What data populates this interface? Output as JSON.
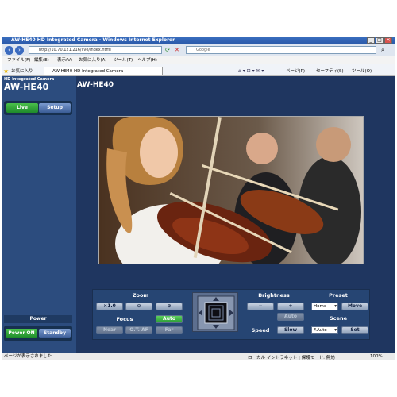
{
  "window": {
    "title": "AW-HE40 HD Integrated Camera - Windows Internet Explorer",
    "min": "_",
    "max": "□",
    "close": "✕"
  },
  "browser": {
    "back_icon": "back-arrow-icon",
    "address": "http://10.70.121.216/live/index.html",
    "search_placeholder": "Google",
    "menu": [
      "ファイル(F)",
      "編集(E)",
      "表示(V)",
      "お気に入り(A)",
      "ツール(T)",
      "ヘルプ(H)"
    ],
    "favorites": "お気に入り",
    "tab_title": "AW-HE40 HD Integrated Camera",
    "toolbar": [
      "ページ(P)",
      "セーフティ(S)",
      "ツール(O)"
    ]
  },
  "app": {
    "product_sub": "HD Integrated Camera",
    "product": "AW-HE40",
    "header_title": "AW-HE40",
    "live": "Live",
    "setup": "Setup",
    "power_label": "Power",
    "power_on": "Power ON",
    "standby": "Standby"
  },
  "controls": {
    "zoom_label": "Zoom",
    "zoom_x1": "×1.0",
    "focus_label": "Focus",
    "focus_auto": "Auto",
    "focus_near": "Near",
    "focus_otaf": "O.T. AF",
    "focus_far": "Far",
    "brightness_label": "Brightness",
    "brightness_minus": "−",
    "brightness_plus": "+",
    "brightness_auto": "Auto",
    "speed_label": "Speed",
    "speed_value": "Slow",
    "preset_label": "Preset",
    "preset_select": "Home",
    "preset_move": "Move",
    "scene_label": "Scene",
    "scene_select": "F.Auto",
    "scene_set": "Set"
  },
  "status": {
    "left": "ページが表示されました",
    "zone": "ローカル イントラネット | 保護モード: 無効",
    "zoom": "100%"
  }
}
